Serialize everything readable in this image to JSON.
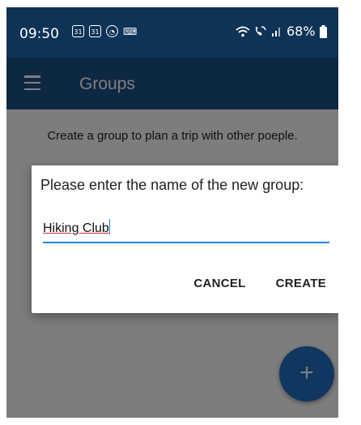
{
  "status_bar": {
    "time": "09:50",
    "left_icons": [
      "calendar-31-icon",
      "calendar-31-icon",
      "sync-icon",
      "keyboard-icon"
    ],
    "right_icons": [
      "wifi-icon",
      "wifi-call-icon",
      "signal-icon",
      "battery-icon"
    ],
    "battery": "68%"
  },
  "app_bar": {
    "title": "Groups",
    "menu_icon": "hamburger-menu-icon"
  },
  "main": {
    "hint": "Create a group to plan a trip with other poeple."
  },
  "dialog": {
    "title": "Please enter the name of the new group:",
    "input_value": "Hiking Club",
    "cancel_label": "CANCEL",
    "create_label": "CREATE"
  },
  "fab": {
    "label": "+",
    "icon": "plus-icon"
  },
  "colors": {
    "status_bar": "#0e3357",
    "app_bar": "#1b5086",
    "accent": "#1e88e5",
    "fab": "#1e6fc0",
    "spellcheck": "#d32f2f"
  }
}
